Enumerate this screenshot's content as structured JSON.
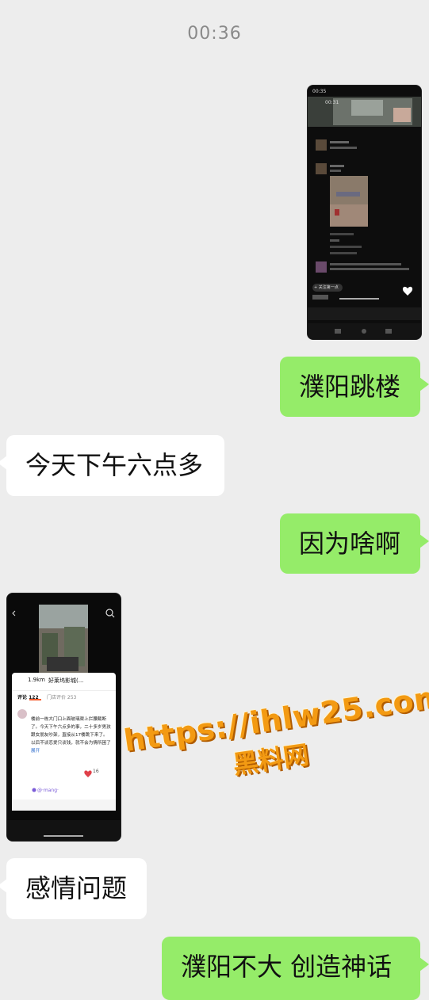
{
  "chat": {
    "timestamp": "00:36",
    "messages": [
      {
        "text": "濮阳跳楼"
      },
      {
        "text": "今天下午六点多"
      },
      {
        "text": "因为啥啊"
      },
      {
        "text": "感情问题"
      },
      {
        "text": "濮阳不大  创造神话"
      }
    ]
  },
  "shot1": {
    "status_time": "00:35",
    "video_time": "00:31",
    "follow_pill": "+ 关注第一点"
  },
  "shot2": {
    "distance": "1.9km",
    "place": "好莱坞影城(...",
    "comments_tab": "评论 122",
    "store_tab": "门店评价 253",
    "comment": "楼前一栋大门口上面玻璃渠上拦腰截断了。今天下午六点多的事，二十多岁男孩跟女朋友吵架，直接从17楼跳下来了。以后不谈恋爱只谈钱，就不会为情所困了",
    "comment_more": "展开",
    "reply_tag": "@·mang·",
    "heart_count": "16"
  },
  "watermark": {
    "url": "https://ihlw25.com",
    "name": "黑料网"
  }
}
